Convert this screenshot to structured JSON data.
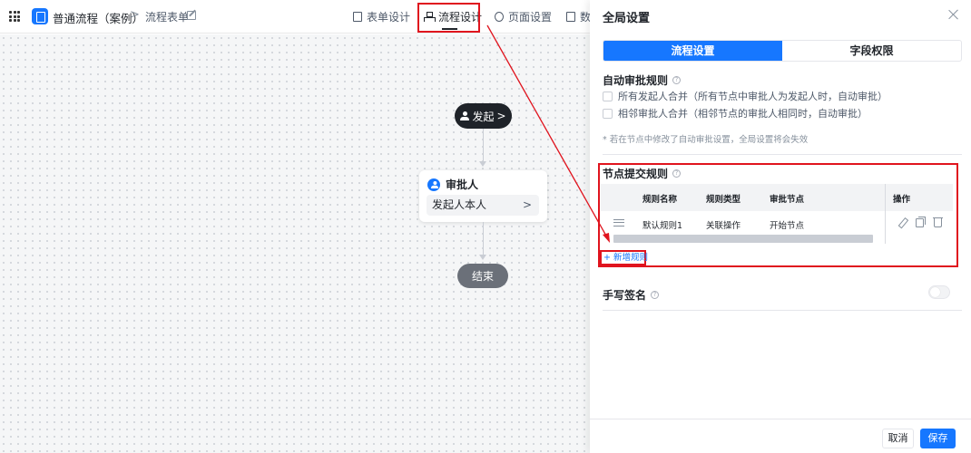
{
  "header": {
    "app_title": "普通流程（案例）",
    "breadcrumb_sep": ">",
    "breadcrumb_form": "流程表单",
    "tabs": [
      {
        "label": "表单设计",
        "icon": "document-icon"
      },
      {
        "label": "流程设计",
        "icon": "flow-icon",
        "active": true
      },
      {
        "label": "页面设置",
        "icon": "gear-icon"
      },
      {
        "label": "数",
        "icon": "table-icon"
      }
    ]
  },
  "canvas": {
    "start_label": "发起",
    "start_chevron": ">",
    "approver_title": "审批人",
    "approver_value": "发起人本人",
    "approver_chevron": ">",
    "end_label": "结束"
  },
  "panel": {
    "title": "全局设置",
    "segments": [
      "流程设置",
      "字段权限"
    ],
    "auto_section": {
      "title": "自动审批规则",
      "options": [
        "所有发起人合并（所有节点中审批人为发起人时，自动审批）",
        "相邻审批人合并（相邻节点的审批人相同时，自动审批）"
      ],
      "hint": "* 若在节点中修改了自动审批设置，全局设置将会失效"
    },
    "submit_section": {
      "title": "节点提交规则",
      "columns": [
        "规则名称",
        "规则类型",
        "审批节点",
        "操作"
      ],
      "rows": [
        {
          "name": "默认规则1",
          "type": "关联操作",
          "node": "开始节点"
        }
      ],
      "add_label": "+ 新增规则"
    },
    "signature_section": {
      "title": "手写签名",
      "enabled": false
    },
    "footer": {
      "cancel": "取消",
      "save": "保存"
    }
  },
  "colors": {
    "accent": "#1677ff",
    "highlight": "#e0141e",
    "start_node": "#1f2329",
    "end_node": "#6b7079"
  }
}
